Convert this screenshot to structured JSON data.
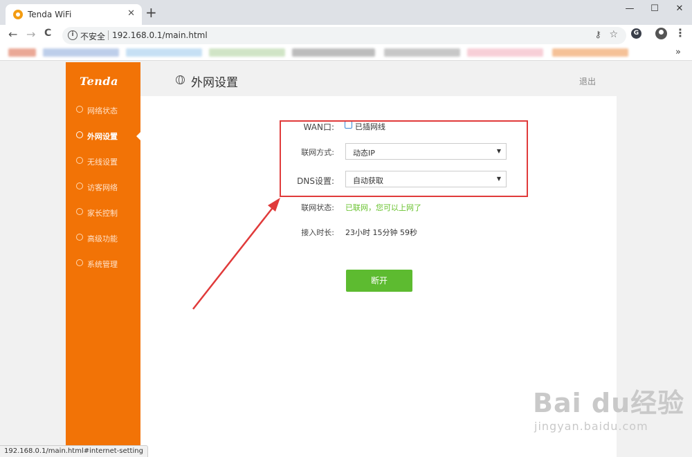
{
  "browser": {
    "tab_title": "Tenda WiFi",
    "tab_close": "✕",
    "new_tab": "+",
    "window_min": "—",
    "window_max": "☐",
    "window_close": "✕",
    "back": "←",
    "forward": "→",
    "reload": "C",
    "info": "i",
    "security_label": "不安全",
    "url": "192.168.0.1/main.html",
    "key": "⚷",
    "star": "☆",
    "ext": "G",
    "menu": "⋮",
    "bookmarks_more": "»"
  },
  "sidebar": {
    "logo": "Tenda",
    "items": [
      {
        "label": "网络状态",
        "icon": "router-icon"
      },
      {
        "label": "外网设置",
        "icon": "globe-icon",
        "active": true
      },
      {
        "label": "无线设置",
        "icon": "wifi-icon"
      },
      {
        "label": "访客网络",
        "icon": "guest-icon"
      },
      {
        "label": "家长控制",
        "icon": "parental-icon"
      },
      {
        "label": "高级功能",
        "icon": "wrench-icon"
      },
      {
        "label": "系统管理",
        "icon": "gear-icon"
      }
    ]
  },
  "header": {
    "title": "外网设置",
    "logout": "退出"
  },
  "form": {
    "wan_label": "WAN口:",
    "wan_status": "已插网线",
    "conn_mode_label": "联网方式:",
    "conn_mode_value": "动态IP",
    "dns_label": "DNS设置:",
    "dns_value": "自动获取",
    "status_label": "联网状态:",
    "status_value": "已联网，您可以上网了",
    "uptime_label": "接入时长:",
    "uptime_value": "23小时 15分钟 59秒",
    "disconnect": "断开",
    "caret": "▼"
  },
  "watermark": {
    "main": "Bai du经验",
    "sub": "jingyan.baidu.com"
  },
  "statusbar": "192.168.0.1/main.html#internet-setting",
  "colors": {
    "sidebar": "#f27306",
    "accent_green": "#5dbb30",
    "annotation_red": "#e03a3a"
  }
}
